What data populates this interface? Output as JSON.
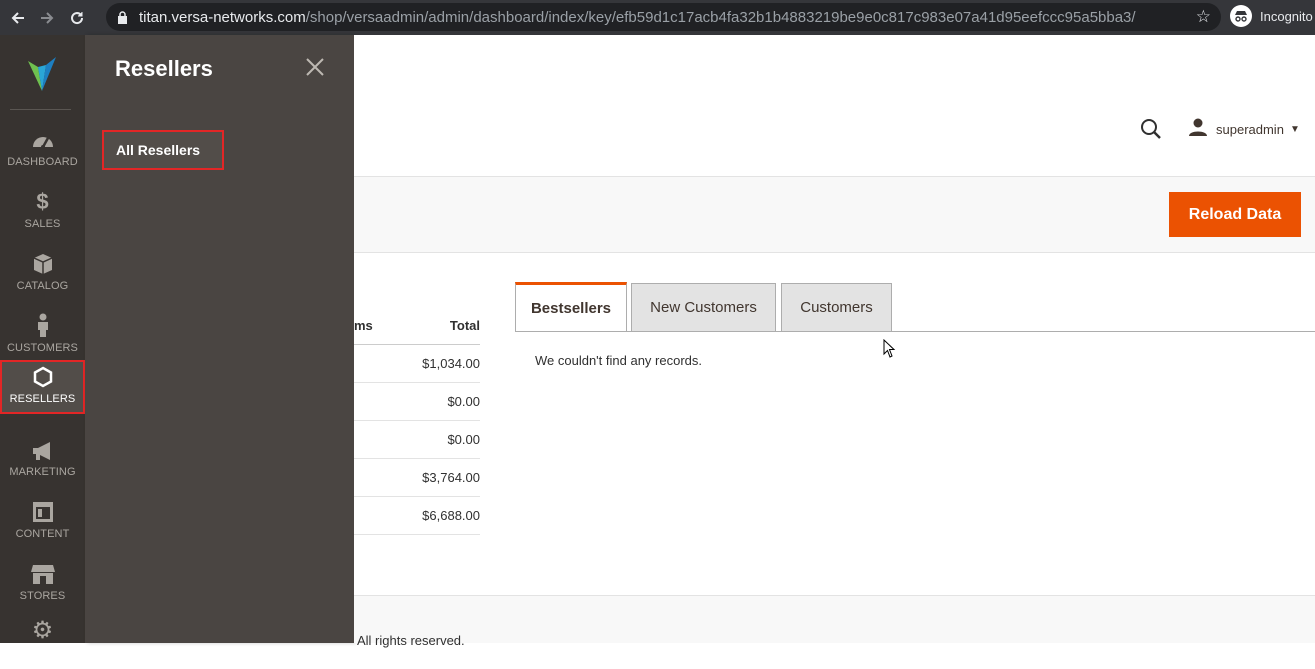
{
  "browser": {
    "url_host": "titan.versa-networks.com",
    "url_path": "/shop/versaadmin/admin/dashboard/index/key/efb59d1c17acb4fa32b1b4883219be9e0c817c983e07a41d95eefccc95a5bba3/",
    "incognito_label": "Incognito"
  },
  "admin_menu": {
    "items": [
      {
        "label": "DASHBOARD",
        "icon": "dashboard-icon"
      },
      {
        "label": "SALES",
        "icon": "dollar-icon"
      },
      {
        "label": "CATALOG",
        "icon": "box-icon"
      },
      {
        "label": "CUSTOMERS",
        "icon": "person-icon"
      },
      {
        "label": "RESELLERS",
        "icon": "hexagon-icon",
        "active": true
      },
      {
        "label": "MARKETING",
        "icon": "megaphone-icon"
      },
      {
        "label": "CONTENT",
        "icon": "layout-icon"
      },
      {
        "label": "STORES",
        "icon": "store-icon"
      },
      {
        "label": "",
        "icon": "gear-icon"
      }
    ]
  },
  "flyout": {
    "title": "Resellers",
    "items": [
      {
        "label": "All Resellers"
      }
    ]
  },
  "header": {
    "username": "superadmin"
  },
  "actions": {
    "reload_label": "Reload Data"
  },
  "dashboard_table": {
    "col_items_partial": "ms",
    "col_total": "Total",
    "rows": [
      "$1,034.00",
      "$0.00",
      "$0.00",
      "$3,764.00",
      "$6,688.00"
    ]
  },
  "tabs": [
    {
      "label": "Bestsellers",
      "active": true
    },
    {
      "label": "New Customers"
    },
    {
      "label": "Customers"
    }
  ],
  "tab_content": {
    "empty_message": "We couldn't find any records."
  },
  "footer": {
    "text_partial": "All rights reserved."
  },
  "colors": {
    "accent": "#eb5202",
    "menu_bg": "#373330",
    "flyout_bg": "#4a4542",
    "highlight_border": "#e22626"
  }
}
